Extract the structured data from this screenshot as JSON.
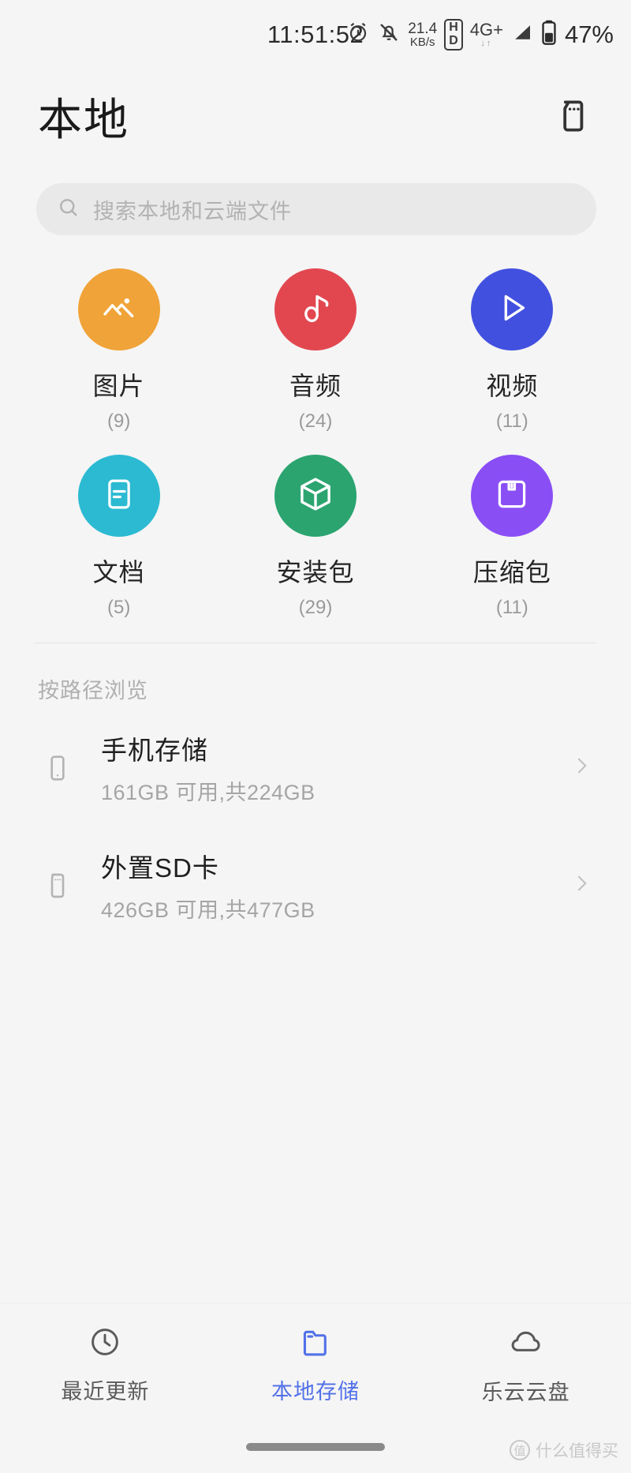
{
  "statusbar": {
    "time": "11:51:52",
    "alarm_icon": "alarm-icon",
    "mute_icon": "bell-muted-icon",
    "netspeed_value": "21.4",
    "netspeed_unit": "KB/s",
    "hd_top": "H",
    "hd_bottom": "D",
    "network_type": "4G+",
    "network_arrows": "↓↑",
    "signal_icon": "signal-bars-icon",
    "battery_icon": "battery-icon",
    "battery_percent": "47%"
  },
  "header": {
    "title": "本地",
    "action_icon": "sd-card-icon"
  },
  "search": {
    "icon": "search-icon",
    "placeholder": "搜索本地和云端文件",
    "value": ""
  },
  "categories": [
    {
      "label": "图片",
      "count": "(9)",
      "color": "#f0a338",
      "icon": "image-icon"
    },
    {
      "label": "音频",
      "count": "(24)",
      "color": "#e2474f",
      "icon": "music-note-icon"
    },
    {
      "label": "视频",
      "count": "(11)",
      "color": "#4250e0",
      "icon": "play-icon"
    },
    {
      "label": "文档",
      "count": "(5)",
      "color": "#2bbad2",
      "icon": "document-icon"
    },
    {
      "label": "安装包",
      "count": "(29)",
      "color": "#2ba470",
      "icon": "package-box-icon"
    },
    {
      "label": "压缩包",
      "count": "(11)",
      "color": "#8a4ef5",
      "icon": "archive-icon"
    }
  ],
  "path_section": {
    "title": "按路径浏览",
    "items": [
      {
        "name": "手机存储",
        "detail": "161GB 可用,共224GB",
        "icon": "phone-storage-icon",
        "chevron": "chevron-right-icon"
      },
      {
        "name": "外置SD卡",
        "detail": "426GB 可用,共477GB",
        "icon": "sd-card-icon",
        "chevron": "chevron-right-icon"
      }
    ]
  },
  "bottom_nav": {
    "active_color": "#5271e8",
    "items": [
      {
        "label": "最近更新",
        "icon": "clock-icon",
        "active": false
      },
      {
        "label": "本地存储",
        "icon": "folder-icon",
        "active": true
      },
      {
        "label": "乐云云盘",
        "icon": "cloud-icon",
        "active": false
      }
    ]
  },
  "watermark": {
    "badge": "值",
    "text": "什么值得买"
  }
}
